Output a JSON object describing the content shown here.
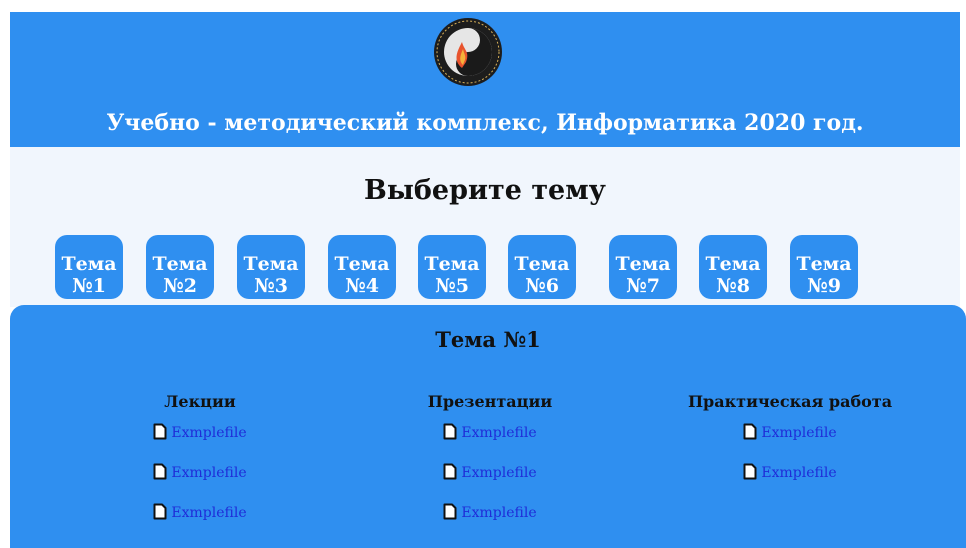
{
  "header": {
    "title": "Учебно - методический комплекс, Информатика 2020 год.",
    "logo_icon": "university-seal-icon"
  },
  "topic_section": {
    "heading": "Выберите тему",
    "topics": [
      {
        "word": "Тема",
        "num": "№1"
      },
      {
        "word": "Тема",
        "num": "№2"
      },
      {
        "word": "Тема",
        "num": "№3"
      },
      {
        "word": "Тема",
        "num": "№4"
      },
      {
        "word": "Тема",
        "num": "№5"
      },
      {
        "word": "Тема",
        "num": "№6"
      },
      {
        "word": "Тема",
        "num": "№7"
      },
      {
        "word": "Тема",
        "num": "№8"
      },
      {
        "word": "Тема",
        "num": "№9"
      }
    ]
  },
  "panel": {
    "title": "Тема №1",
    "columns": [
      {
        "title": "Лекции",
        "files": [
          "Exmplefile",
          "Exmplefile",
          "Exmplefile"
        ]
      },
      {
        "title": "Презентации",
        "files": [
          "Exmplefile",
          "Exmplefile",
          "Exmplefile"
        ]
      },
      {
        "title": "Практическая работа",
        "files": [
          "Exmplefile",
          "Exmplefile"
        ]
      }
    ]
  },
  "colors": {
    "accent_blue": "#2f8ff0",
    "band_bg": "#f1f6fd",
    "link_blue": "#1f2dd8"
  }
}
